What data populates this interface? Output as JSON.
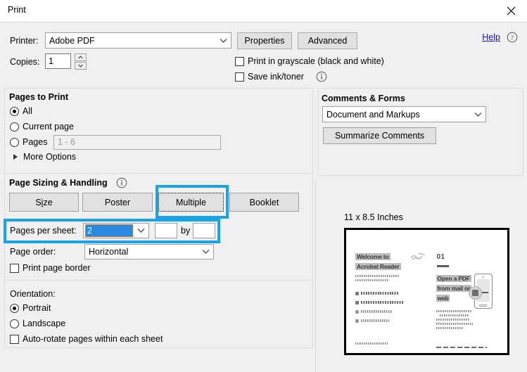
{
  "window": {
    "title": "Print",
    "close_icon": "close-x-icon"
  },
  "printer": {
    "label": "Printer:",
    "value": "Adobe PDF",
    "properties_button": "Properties",
    "advanced_button": "Advanced",
    "help_link": "Help",
    "help_icon": "question-circle-icon"
  },
  "copies": {
    "label": "Copies:",
    "value": "1",
    "spinner_up_icon": "chevron-up-icon",
    "spinner_down_icon": "chevron-down-icon"
  },
  "print_options": {
    "grayscale_label": "Print in grayscale (black and white)",
    "grayscale_checked": false,
    "save_ink_label": "Save ink/toner",
    "save_ink_checked": false,
    "save_ink_info_icon": "info-circle-icon"
  },
  "pages_to_print": {
    "title": "Pages to Print",
    "options": [
      {
        "label": "All",
        "selected": true
      },
      {
        "label": "Current page",
        "selected": false
      },
      {
        "label": "Pages",
        "selected": false
      }
    ],
    "pages_input_placeholder": "1 - 6",
    "pages_input_value": "",
    "more_options_label": "More Options",
    "more_options_icon": "triangle-right-icon"
  },
  "page_sizing": {
    "title": "Page Sizing & Handling",
    "info_icon": "info-circle-icon",
    "tabs": [
      {
        "label": "Size",
        "accelerator": "i",
        "selected": false
      },
      {
        "label": "Poster",
        "selected": false
      },
      {
        "label": "Multiple",
        "selected": true
      },
      {
        "label": "Booklet",
        "selected": false
      }
    ],
    "pages_per_sheet_label": "Pages per sheet:",
    "pages_per_sheet_value": "2",
    "custom_x_value": "",
    "by_label": "by",
    "custom_y_value": "",
    "page_order_label": "Page order:",
    "page_order_value": "Horizontal",
    "print_page_border_label": "Print page border",
    "print_page_border_checked": false,
    "dropdown_icon": "chevron-down-icon"
  },
  "orientation": {
    "label": "Orientation:",
    "options": [
      {
        "label": "Portrait",
        "selected": true
      },
      {
        "label": "Landscape",
        "selected": false
      }
    ],
    "auto_rotate_label": "Auto-rotate pages within each sheet",
    "auto_rotate_checked": false
  },
  "comments_forms": {
    "title": "Comments & Forms",
    "value": "Document and Markups",
    "summarize_button": "Summarize Comments",
    "dropdown_icon": "chevron-down-icon"
  },
  "preview": {
    "size_label": "11 x 8.5 Inches",
    "left_page": {
      "heading_line1": "Welcome to",
      "heading_line2": "Acrobat Reader",
      "list": [
        "",
        "",
        "",
        ""
      ],
      "footer": ""
    },
    "right_page": {
      "page_number": "01",
      "heading_line1": "Open a PDF",
      "heading_line2": "from mail or",
      "heading_line3": "web"
    }
  },
  "colors": {
    "highlight": "#1aa3e8",
    "selection": "#2a88e0",
    "link": "#1a0dab",
    "dialog_bg": "#f0f0f0",
    "button_bg": "#e1e1e1"
  }
}
